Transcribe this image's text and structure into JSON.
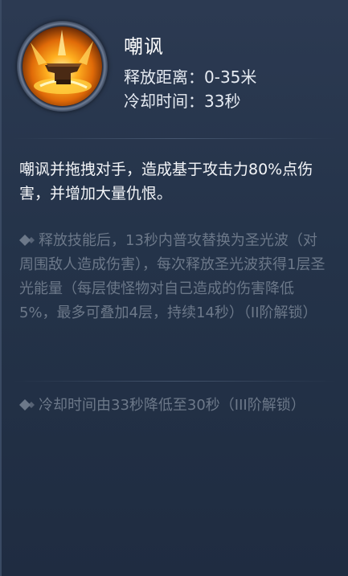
{
  "skill": {
    "name": "嘲讽",
    "range_label": "释放距离：",
    "range_value": "0-35米",
    "cooldown_label": "冷却时间：",
    "cooldown_value": "33秒",
    "icon": "anvil-fire-skill-icon"
  },
  "description": "嘲讽并拖拽对手，造成基于攻击力80%点伤害，并增加大量仇恨。",
  "upgrades": [
    {
      "bullet_icon": "diamond-bullet-icon",
      "text": "释放技能后，13秒内普攻替换为圣光波（对周围敌人造成伤害），每次释放圣光波获得1层圣光能量（每层使怪物对自己造成的伤害降低5%，最多可叠加4层，持续14秒）（II阶解锁）"
    },
    {
      "bullet_icon": "diamond-bullet-icon",
      "text": "冷却时间由33秒降低至30秒（III阶解锁）"
    }
  ],
  "colors": {
    "background": "#243349",
    "text_primary": "#f3f5f8",
    "text_locked": "#6c7889"
  }
}
